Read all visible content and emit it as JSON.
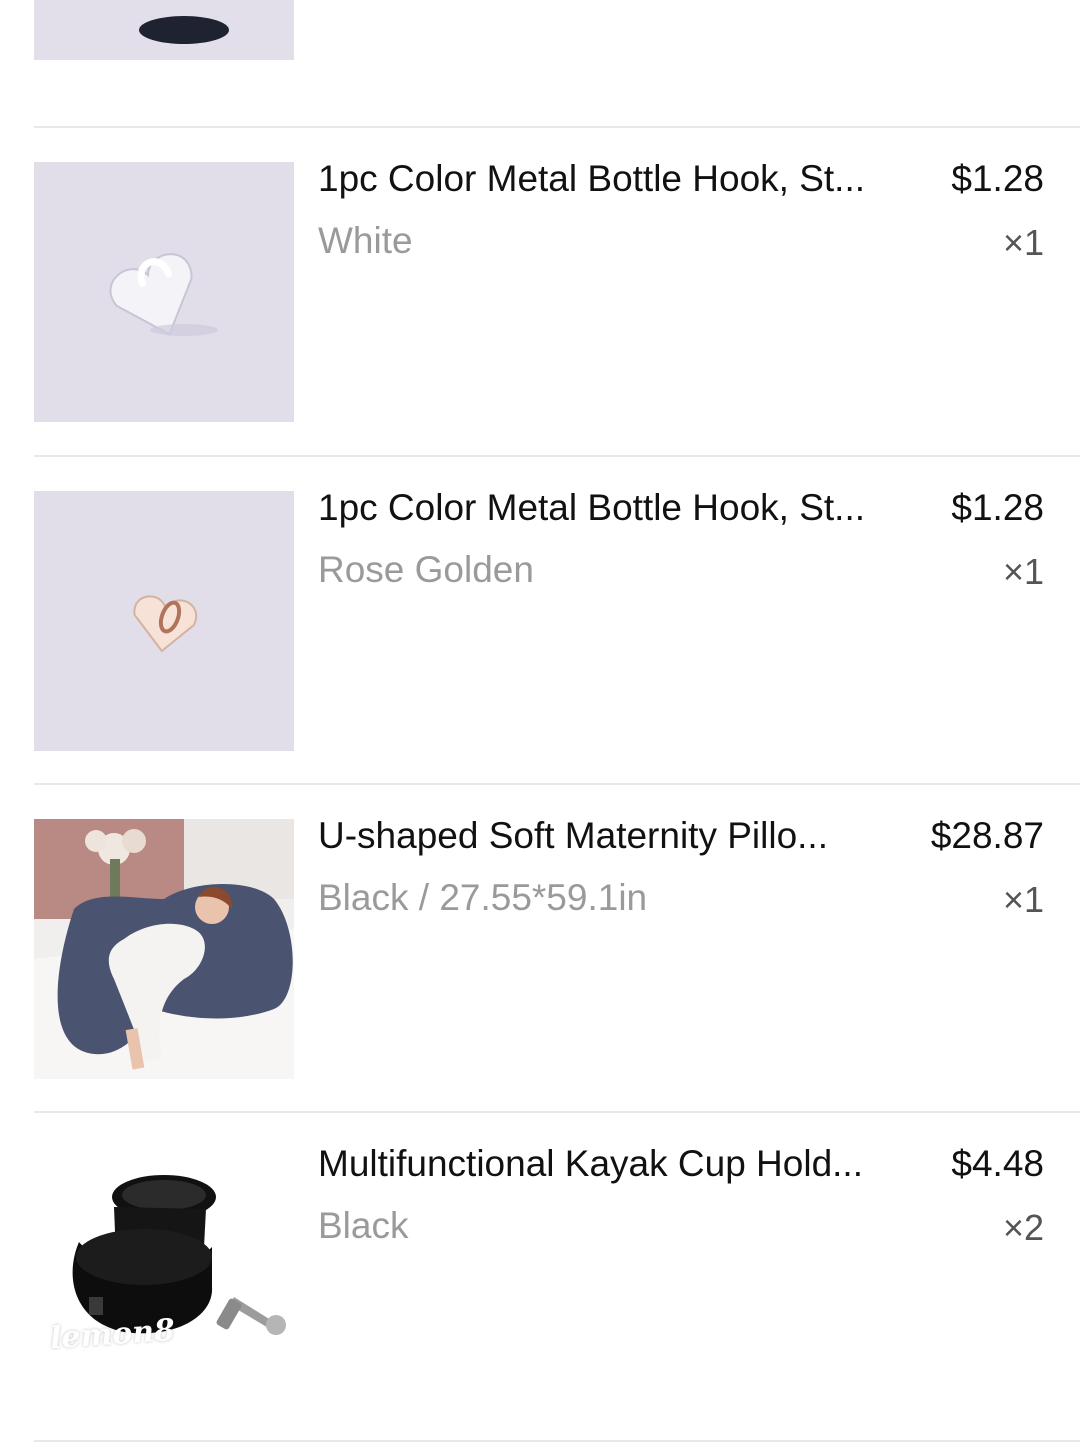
{
  "order_items": [
    {
      "title": "1pc Color Metal Bottle Hook, St...",
      "variant": "White",
      "price": "$1.28",
      "quantity": "×1",
      "image": "white-heart-hook-product-image"
    },
    {
      "title": "1pc Color Metal Bottle Hook, St...",
      "variant": "Rose Golden",
      "price": "$1.28",
      "quantity": "×1",
      "image": "rose-gold-heart-hook-product-image"
    },
    {
      "title": "U-shaped Soft Maternity Pillo...",
      "variant": "Black / 27.55*59.1in",
      "price": "$28.87",
      "quantity": "×1",
      "image": "maternity-pillow-product-image"
    },
    {
      "title": "Multifunctional Kayak Cup Hold...",
      "variant": "Black",
      "price": "$4.48",
      "quantity": "×2",
      "image": "kayak-cup-holder-product-image"
    }
  ],
  "watermark": "lemon8",
  "colors": {
    "title": "#111111",
    "variant": "#9a9a9a",
    "quantity": "#555555",
    "divider": "#e8e8e8",
    "thumb_bg": "#e2dfea"
  }
}
